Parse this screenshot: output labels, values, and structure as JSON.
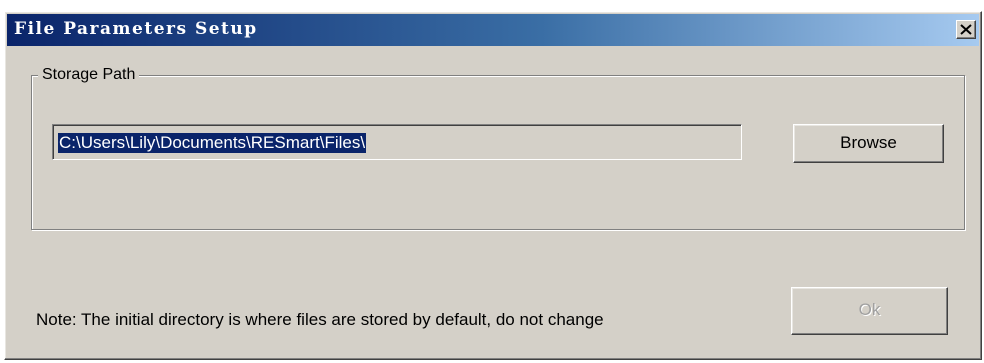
{
  "window": {
    "title": "File Parameters Setup"
  },
  "storage": {
    "group_label": "Storage Path",
    "path_value": "C:\\Users\\Lily\\Documents\\RESmart\\Files\\",
    "browse_label": "Browse"
  },
  "footer": {
    "note": "Note: The initial directory is where files are stored by default, do not change",
    "ok_label": "Ok",
    "ok_enabled": false
  },
  "icons": {
    "close": "close-icon"
  },
  "colors": {
    "title_gradient_start": "#0a246a",
    "title_gradient_end": "#a6caf0",
    "dialog_background": "#d4d0c8",
    "selection_background": "#0a246a",
    "disabled_text": "#a0a0a0"
  }
}
